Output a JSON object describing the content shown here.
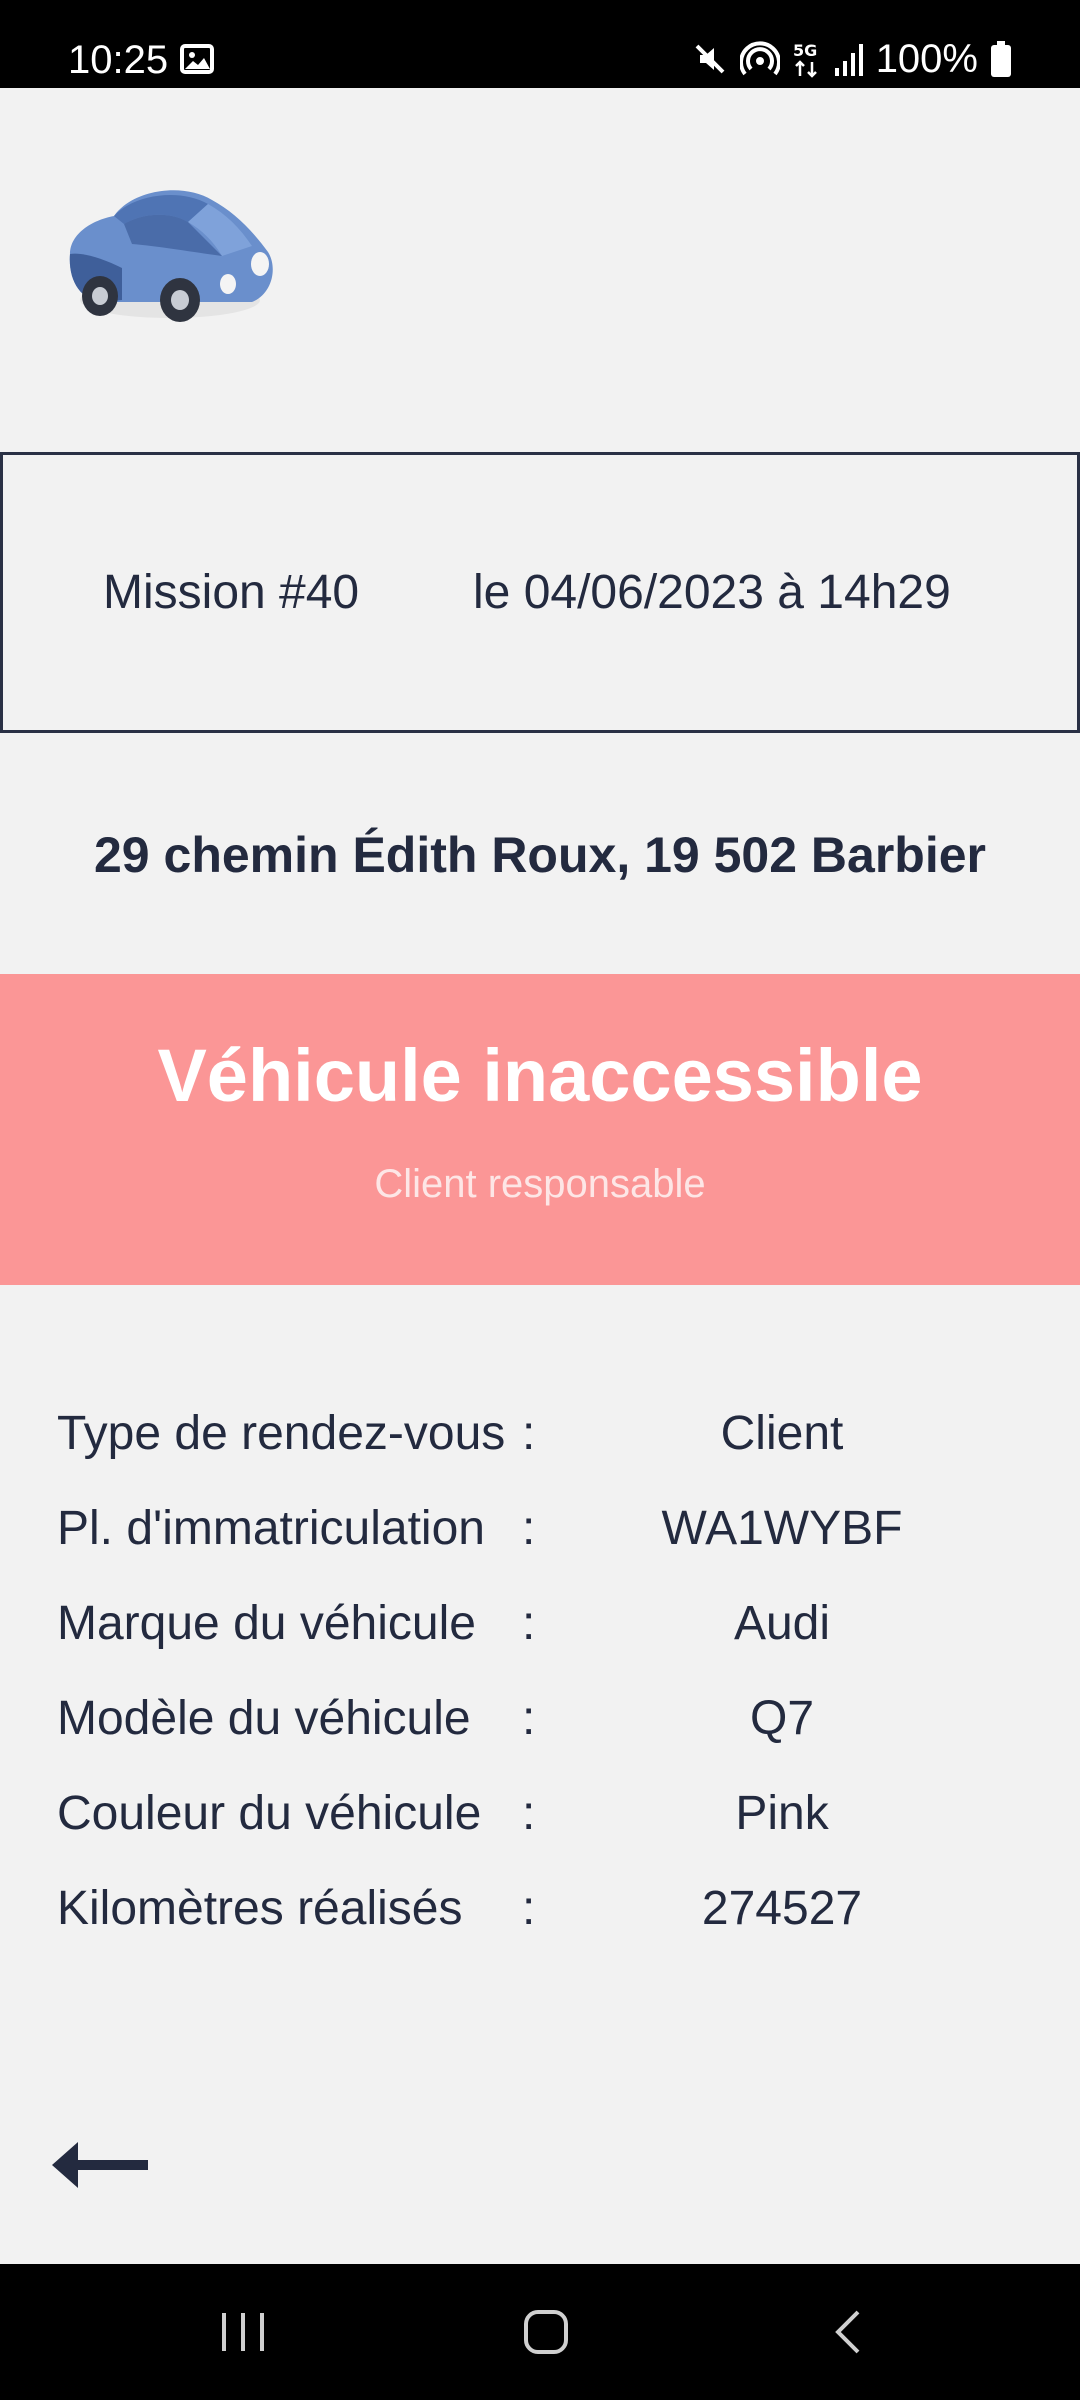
{
  "status_bar": {
    "time": "10:25",
    "battery": "100%",
    "icons": [
      "image-icon",
      "mute-icon",
      "hotspot-icon",
      "5g-icon",
      "signal-icon",
      "battery-icon"
    ]
  },
  "logo": {
    "icon": "car-icon",
    "colors": {
      "body": "#6a8fcc",
      "dark": "#3f5f9a",
      "wheel": "#2f3440"
    }
  },
  "mission": {
    "number": "Mission #40",
    "datetime": "le 04/06/2023 à 14h29"
  },
  "address": "29 chemin Édith Roux, 19 502 Barbier",
  "alert": {
    "title": "Véhicule inaccessible",
    "subtitle": "Client responsable",
    "color": "#fb9696"
  },
  "details": [
    {
      "label": "Type de rendez-vous",
      "colon": ":",
      "value": "Client"
    },
    {
      "label": "Pl. d'immatriculation",
      "colon": ":",
      "value": "WA1WYBF"
    },
    {
      "label": "Marque du véhicule",
      "colon": ":",
      "value": "Audi"
    },
    {
      "label": "Modèle du véhicule",
      "colon": ":",
      "value": "Q7"
    },
    {
      "label": "Couleur du véhicule",
      "colon": ":",
      "value": "Pink"
    },
    {
      "label": "Kilomètres réalisés",
      "colon": ":",
      "value": "274527"
    }
  ],
  "back_button": {
    "icon": "back-arrow-icon"
  },
  "nav_bar": {
    "buttons": [
      "recent-apps-icon",
      "home-icon",
      "back-icon"
    ]
  },
  "theme": {
    "text": "#232a3f",
    "background": "#f2f2f2"
  }
}
